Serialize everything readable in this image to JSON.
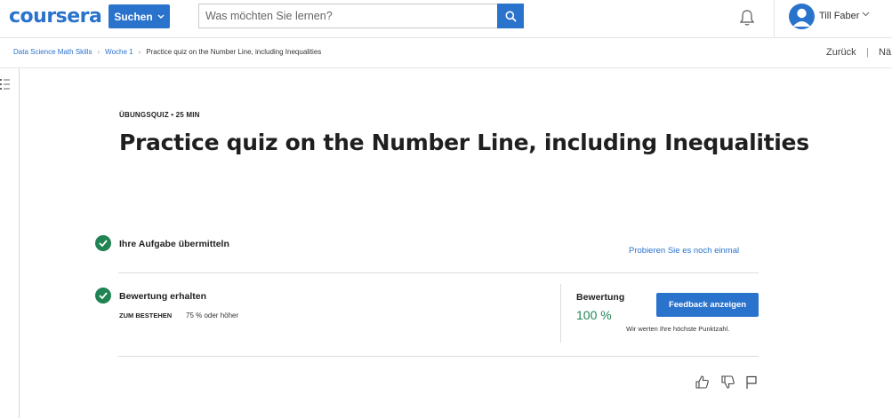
{
  "header": {
    "logo": "coursera",
    "search_button_label": "Suchen",
    "search_placeholder": "Was möchten Sie lernen?",
    "user_name": "Till Faber"
  },
  "breadcrumb": {
    "items": [
      "Data Science Math Skills",
      "Woche 1"
    ],
    "current": "Practice quiz on the Number Line, including Inequalities"
  },
  "nav": {
    "back": "Zurück",
    "divider": "|",
    "next": "Nä"
  },
  "quiz": {
    "meta": "ÜBUNGSQUIZ • 25 MIN",
    "title": "Practice quiz on the Number Line, including Inequalities"
  },
  "steps": {
    "submit_label": "Ihre Aufgabe übermitteln",
    "retry_link": "Probieren Sie es noch einmal",
    "grade_received_label": "Bewertung erhalten",
    "pass_label": "ZUM BESTEHEN",
    "pass_value": "75 % oder höher"
  },
  "grade": {
    "label": "Bewertung",
    "value": "100 %",
    "feedback_button": "Feedback anzeigen",
    "note": "Wir werten Ihre höchste Punktzahl."
  },
  "colors": {
    "accent": "#2a73cc",
    "success": "#1f8354"
  },
  "icons": [
    "search-icon",
    "bell-icon",
    "avatar-icon",
    "chevron-down-icon",
    "table-of-contents-icon",
    "check-circle-icon",
    "thumbs-up-icon",
    "thumbs-down-icon",
    "flag-icon"
  ]
}
